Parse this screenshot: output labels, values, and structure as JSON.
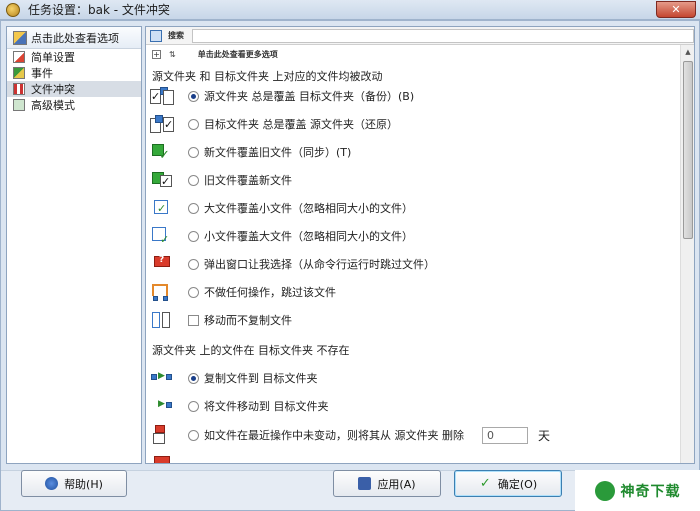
{
  "window": {
    "title": "任务设置：bak - 文件冲突",
    "close_glyph": "✕"
  },
  "sidebar": {
    "more_options": "点击此处查看选项",
    "items": [
      {
        "label": "简单设置"
      },
      {
        "label": "事件"
      },
      {
        "label": "文件冲突"
      },
      {
        "label": "高级模式"
      }
    ]
  },
  "toolbar": {
    "search_label": "搜索",
    "search_value": ""
  },
  "content": {
    "expander": "+",
    "more_label": "单击此处查看更多选项",
    "section1": "源文件夹 和 目标文件夹 上对应的文件均被改动",
    "options": [
      {
        "label": "源文件夹 总是覆盖 目标文件夹（备份）(B)",
        "checked": true
      },
      {
        "label": "目标文件夹 总是覆盖 源文件夹（还原）"
      },
      {
        "label": "新文件覆盖旧文件（同步）(T)"
      },
      {
        "label": "旧文件覆盖新文件"
      },
      {
        "label": "大文件覆盖小文件（忽略相同大小的文件）"
      },
      {
        "label": "小文件覆盖大文件（忽略相同大小的文件）"
      },
      {
        "label": "弹出窗口让我选择（从命令行运行时跳过文件）"
      },
      {
        "label": "不做任何操作，跳过该文件"
      }
    ],
    "move_not_copy": "移动而不复制文件",
    "section2": "源文件夹 上的文件在 目标文件夹 不存在",
    "options2": [
      {
        "label": "复制文件到 目标文件夹",
        "checked": true
      },
      {
        "label": "将文件移动到 目标文件夹"
      },
      {
        "label": "如文件在最近操作中未变动，则将其从 源文件夹 删除"
      }
    ],
    "days_value": "0",
    "days_unit": "天"
  },
  "buttons": {
    "help": "帮助(H)",
    "apply": "应用(A)",
    "ok": "确定(O)"
  },
  "watermark": {
    "text": "神奇下载"
  }
}
